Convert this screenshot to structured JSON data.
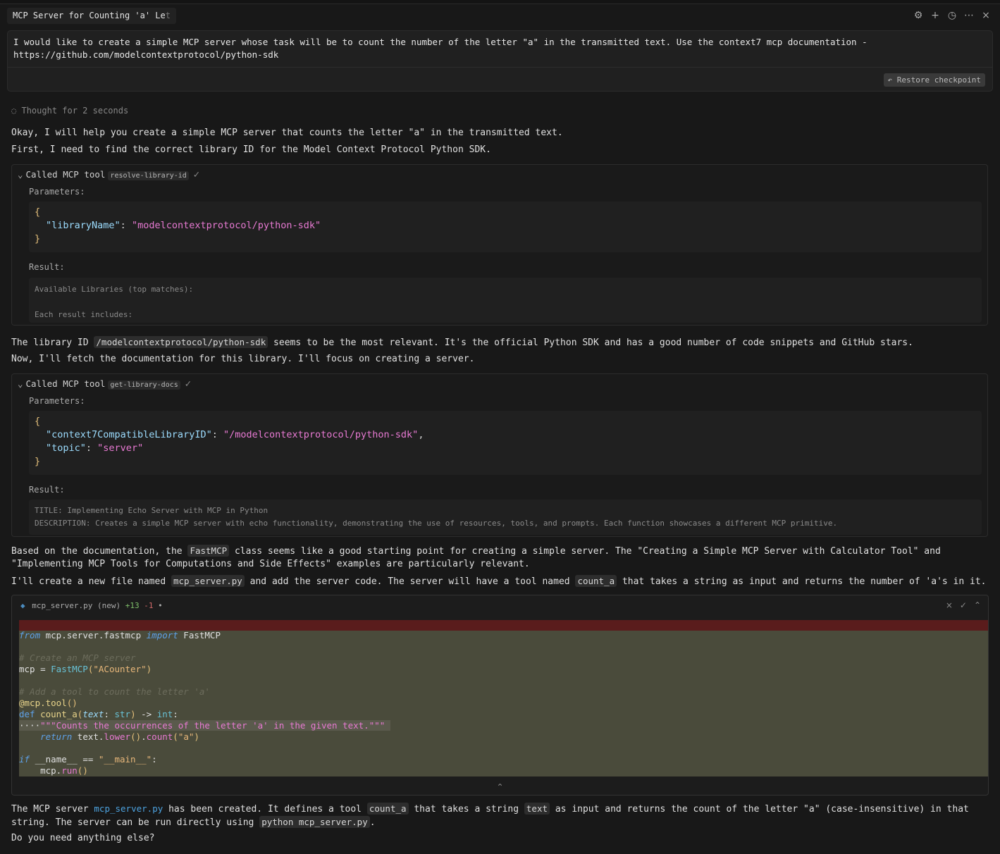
{
  "tab": {
    "title_main": "MCP Server for Counting 'a' Le",
    "title_fade": "t"
  },
  "top_icons": [
    "gear-icon",
    "plus-icon",
    "history-icon",
    "more-icon",
    "close-icon"
  ],
  "prompt": {
    "line1": "I would like to create a simple MCP server whose task will be to count the number of the letter \"a\" in the transmitted text. Use the context7 mcp documentation -",
    "line2": "https://github.com/modelcontextprotocol/python-sdk",
    "restore_label": "Restore checkpoint"
  },
  "thought": "Thought for 2 seconds",
  "messages": {
    "m1": "Okay, I will help you create a simple MCP server that counts the letter \"a\" in the transmitted text.",
    "m2": "First, I need to find the correct library ID for the Model Context Protocol Python SDK.",
    "m3_pre": "The library ID ",
    "m3_code": "/modelcontextprotocol/python-sdk",
    "m3_post": " seems to be the most relevant. It's the official Python SDK and has a good number of code snippets and GitHub stars.",
    "m4": "Now, I'll fetch the documentation for this library. I'll focus on creating a server.",
    "m5_pre": "Based on the documentation, the ",
    "m5_code": "FastMCP",
    "m5_post": " class seems like a good starting point for creating a simple server. The \"Creating a Simple MCP Server with Calculator Tool\" and \"Implementing MCP Tools for Computations and Side Effects\" examples are particularly relevant.",
    "m6_pre": "I'll create a new file named ",
    "m6_code1": "mcp_server.py",
    "m6_mid": " and add the server code. The server will have a tool named ",
    "m6_code2": "count_a",
    "m6_post": " that takes a string as input and returns the number of 'a's in it.",
    "m7_a": "The MCP server ",
    "m7_link": "mcp_server.py",
    "m7_b": " has been created. It defines a tool ",
    "m7_code1": "count_a",
    "m7_c": " that takes a string ",
    "m7_code2": "text",
    "m7_d": " as input and returns the count of the letter \"a\" (case-insensitive) in that string. The server can be run directly using ",
    "m7_code3": "python mcp_server.py",
    "m7_e": ".",
    "m8": "Do you need anything else?"
  },
  "tool1": {
    "called": "Called MCP tool",
    "name": "resolve-library-id",
    "params_label": "Parameters:",
    "key": "\"libraryName\"",
    "value": "\"modelcontextprotocol/python-sdk\"",
    "result_label": "Result:",
    "result_line1": "Available Libraries (top matches):",
    "result_line2": "Each result includes:"
  },
  "tool2": {
    "called": "Called MCP tool",
    "name": "get-library-docs",
    "params_label": "Parameters:",
    "key1": "\"context7CompatibleLibraryID\"",
    "value1": "\"/modelcontextprotocol/python-sdk\"",
    "key2": "\"topic\"",
    "value2": "\"server\"",
    "result_label": "Result:",
    "result_line1": "TITLE: Implementing Echo Server with MCP in Python",
    "result_line2": "DESCRIPTION: Creates a simple MCP server with echo functionality, demonstrating the use of resources, tools, and prompts. Each function showcases a different MCP primitive."
  },
  "editor": {
    "filename": "mcp_server.py",
    "status": "(new)",
    "added": "+13",
    "removed": "-1",
    "dot": "•"
  },
  "colors": {
    "added_band": "#4a4b3b",
    "removed_band": "#5a1c1c",
    "link": "#4da3e0"
  }
}
